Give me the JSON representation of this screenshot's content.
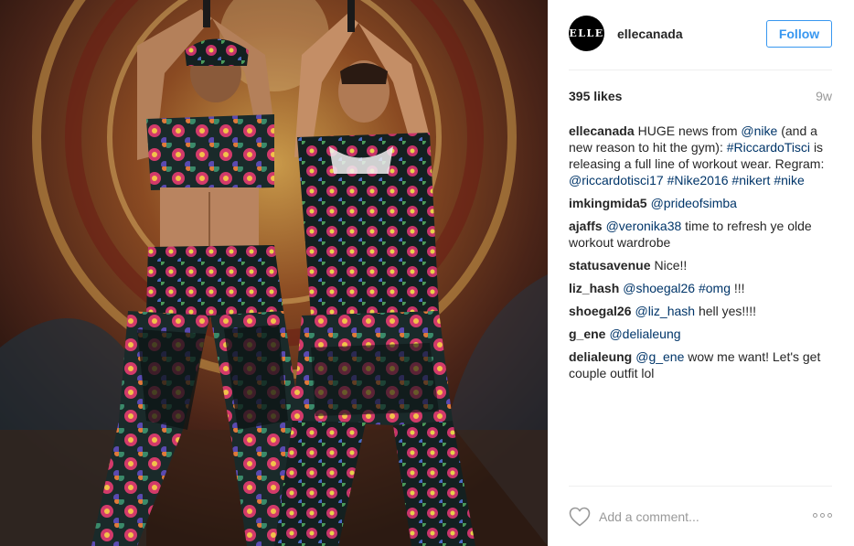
{
  "post": {
    "username": "ellecanada",
    "avatar_text": "ELLE",
    "follow_label": "Follow",
    "likes": "395 likes",
    "time_ago": "9w"
  },
  "caption": {
    "user": "ellecanada",
    "t1": "HUGE news from",
    "m1": "@nike",
    "t2": "(and a new reason to hit the gym):",
    "h1": "#RiccardoTisci",
    "t3": "is releasing a full line of workout wear. Regram:",
    "m2": "@riccardotisci17",
    "h2": "#Nike2016",
    "h3": "#nikert",
    "h4": "#nike"
  },
  "comments": [
    {
      "user": "imkingmida5",
      "mention": "@prideofsimba"
    },
    {
      "user": "ajaffs",
      "mention": "@veronika38",
      "text": "time to refresh ye olde workout wardrobe"
    },
    {
      "user": "statusavenue",
      "text": "Nice!!"
    },
    {
      "user": "liz_hash",
      "mention": "@shoegal26",
      "tag": "#omg",
      "text": "!!!"
    },
    {
      "user": "shoegal26",
      "mention": "@liz_hash",
      "text": "hell yes!!!!"
    },
    {
      "user": "g_ene",
      "mention": "@delialeung"
    },
    {
      "user": "delialeung",
      "mention": "@g_ene",
      "text": "wow me want! Let's get couple outfit lol"
    }
  ],
  "footer": {
    "comment_placeholder": "Add a comment...",
    "heart_icon": "heart-outline-icon",
    "more_icon": "more-options-icon"
  },
  "colors": {
    "accent": "#3897f0",
    "link": "#003569",
    "muted": "#999999",
    "text": "#262626"
  }
}
